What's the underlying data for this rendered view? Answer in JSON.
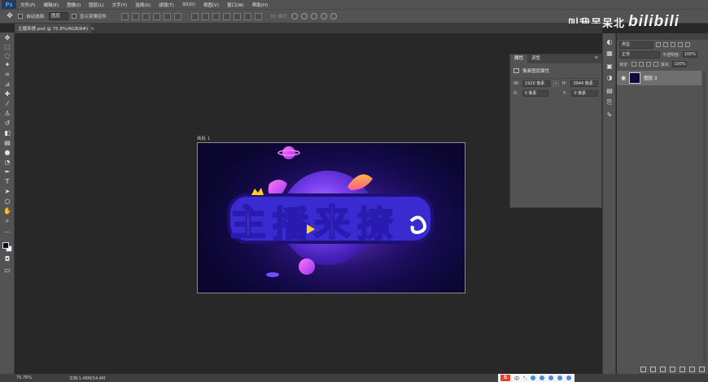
{
  "app": {
    "logo": "Ps"
  },
  "menu": [
    "文件(F)",
    "编辑(E)",
    "图像(I)",
    "图层(L)",
    "文字(Y)",
    "选择(S)",
    "滤镜(T)",
    "3D(D)",
    "视图(V)",
    "窗口(W)",
    "帮助(H)"
  ],
  "options": {
    "auto_select_label": "自动选择:",
    "auto_select_value": "图层",
    "show_transform_label": "显示变换控件",
    "mode_3d_label": "3D 模式:"
  },
  "watermark": {
    "text": "叫我呆呆北",
    "logo": "bilibili"
  },
  "document": {
    "tab_title": "主播来撩.psd @ 75.8%(RGB/8#)",
    "artboard_label": "画板 1"
  },
  "properties": {
    "tab_properties": "属性",
    "tab_adjustments": "调整",
    "header": "像素图层属性",
    "w_label": "W:",
    "w_value": "1920 像素",
    "h_label": "H:",
    "h_value": "3944 像素",
    "x_label": "X:",
    "x_value": "0 像素",
    "y_label": "Y:",
    "y_value": "0 像素"
  },
  "layers": {
    "kind_filter": "类型",
    "blend_mode": "正常",
    "opacity_label": "不透明度:",
    "opacity_value": "100%",
    "lock_label": "锁定:",
    "fill_label": "填充:",
    "fill_value": "100%",
    "layer_name": "图层 3"
  },
  "status": {
    "zoom": "75.76%",
    "doc_size": "文档:1.48M/14.4M"
  },
  "ime": {
    "logo": "S",
    "items": [
      "中",
      "ᵒ,"
    ]
  },
  "colors": {
    "foreground": "#0d0c24",
    "background": "#ffffff"
  },
  "icons": [
    "move-tool-icon",
    "marquee-tool-icon",
    "lasso-tool-icon",
    "magic-wand-icon",
    "crop-tool-icon",
    "eyedropper-icon",
    "healing-brush-icon",
    "brush-tool-icon",
    "clone-stamp-icon",
    "history-brush-icon",
    "eraser-icon",
    "gradient-tool-icon",
    "blur-tool-icon",
    "dodge-tool-icon",
    "pen-tool-icon",
    "type-tool-icon",
    "path-select-icon",
    "shape-tool-icon",
    "hand-tool-icon",
    "zoom-tool-icon",
    "eye-icon"
  ]
}
